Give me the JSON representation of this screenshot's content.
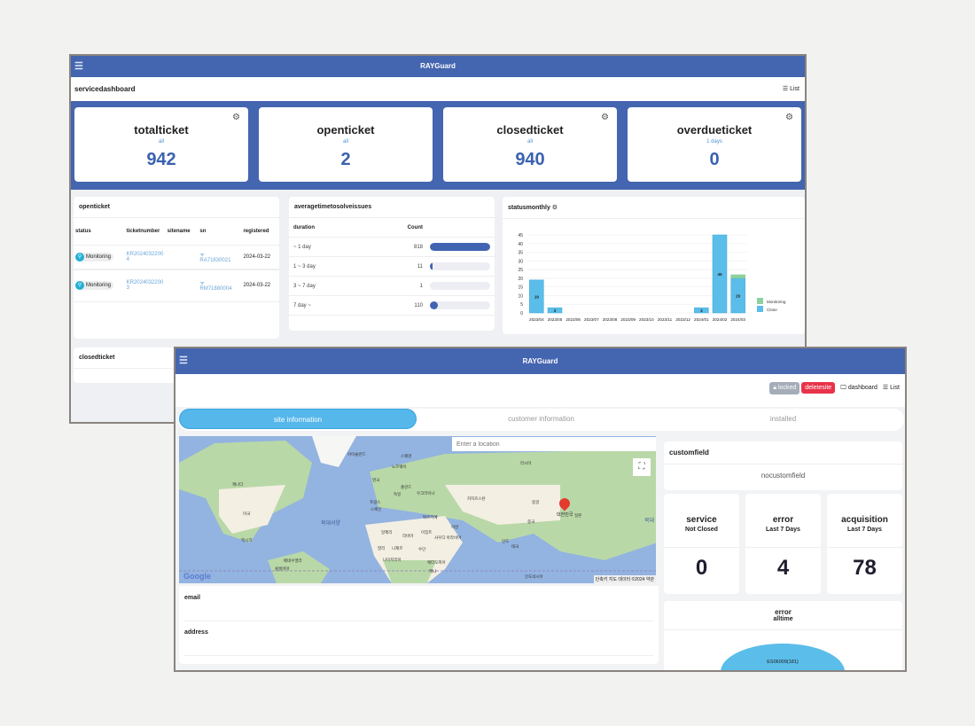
{
  "win1": {
    "title": "RAYGuard",
    "page": "servicedashboard",
    "list_label": "List",
    "kpis": [
      {
        "title": "totalticket",
        "sub": "all",
        "value": "942"
      },
      {
        "title": "openticket",
        "sub": "all",
        "value": "2"
      },
      {
        "title": "closedticket",
        "sub": "all",
        "value": "940"
      },
      {
        "title": "overdueticket",
        "sub": "1 days",
        "value": "0"
      }
    ],
    "openticket": {
      "title": "openticket",
      "headers": [
        "status",
        "ticketnumber",
        "sitename",
        "sn",
        "registered"
      ],
      "rows": [
        {
          "status": "Monitoring",
          "ticket": "KR20240322004",
          "site": "",
          "sn": "RA71830021",
          "registered": "2024-03-22"
        },
        {
          "status": "Monitoring",
          "ticket": "KR20240322003",
          "site": "",
          "sn": "RM71880004",
          "registered": "2024-03-22"
        }
      ]
    },
    "avg": {
      "title": "averagetimetosolveissues",
      "headers": [
        "duration",
        "Count"
      ],
      "rows": [
        {
          "label": "~ 1 day",
          "count": "818",
          "pct": 100
        },
        {
          "label": "1 ~ 3 day",
          "count": "11",
          "pct": 1.3
        },
        {
          "label": "3 ~ 7 day",
          "count": "1",
          "pct": 0.1
        },
        {
          "label": "7 day ~",
          "count": "110",
          "pct": 13.4
        }
      ]
    },
    "closedticket": {
      "title": "closedticket"
    }
  },
  "chart_data": {
    "type": "bar",
    "stacked": true,
    "title": "statusmonthly",
    "xlabel": "",
    "ylabel": "",
    "ylim": [
      0,
      45
    ],
    "yticks": [
      0,
      5,
      10,
      15,
      20,
      25,
      30,
      35,
      40,
      45
    ],
    "grid": true,
    "legend": "right",
    "categories": [
      "2023/04",
      "2023/05",
      "2023/06",
      "2023/07",
      "2023/08",
      "2023/09",
      "2023/10",
      "2023/11",
      "2023/12",
      "2024/01",
      "2024/02",
      "2024/03"
    ],
    "series": [
      {
        "name": "Close",
        "color": "#5bbde9",
        "values": [
          19,
          3,
          0,
          0,
          0,
          0,
          0,
          0,
          0,
          3,
          45,
          20
        ]
      },
      {
        "name": "Monitoring",
        "color": "#8fd19e",
        "values": [
          0,
          0,
          0,
          0,
          0,
          0,
          0,
          0,
          0,
          0,
          0,
          2
        ]
      }
    ]
  },
  "win2": {
    "title": "RAYGuard",
    "locked": "locked",
    "deletesite": "deletesite",
    "dashboard": "dashboard",
    "list": "List",
    "tabs": [
      "site information",
      "customer information",
      "installed"
    ],
    "map": {
      "placeholder": "Enter a location",
      "ocean": "북대서양",
      "ocean2": "북대",
      "marker": "대한민국",
      "google": "Google",
      "attribution": "단축키  지도 데이터 ©2024",
      "terms": "약관",
      "labels": [
        {
          "t": "캐나다"
        },
        {
          "t": "미국"
        },
        {
          "t": "멕시코"
        },
        {
          "t": "러시아"
        },
        {
          "t": "중국"
        },
        {
          "t": "몽골"
        },
        {
          "t": "카자흐스탄"
        },
        {
          "t": "인도"
        },
        {
          "t": "일본"
        },
        {
          "t": "알제리"
        },
        {
          "t": "리비아"
        },
        {
          "t": "이집트"
        },
        {
          "t": "말리"
        },
        {
          "t": "니제르"
        },
        {
          "t": "나이지리아"
        },
        {
          "t": "에티오피아"
        },
        {
          "t": "사우디 아라비아"
        },
        {
          "t": "이란"
        },
        {
          "t": "튀르키예"
        },
        {
          "t": "프랑스"
        },
        {
          "t": "독일"
        },
        {
          "t": "영국"
        },
        {
          "t": "스페인"
        },
        {
          "t": "폴란드"
        },
        {
          "t": "우크라이나"
        },
        {
          "t": "아이슬란드"
        },
        {
          "t": "스웨덴"
        },
        {
          "t": "노르웨이"
        },
        {
          "t": "베네수엘라"
        },
        {
          "t": "콜롬비아"
        },
        {
          "t": "태국"
        },
        {
          "t": "인도네시아"
        },
        {
          "t": "케냐"
        },
        {
          "t": "수단"
        }
      ]
    },
    "email_label": "email",
    "address_label": "address",
    "customfield": {
      "title": "customfield",
      "empty": "nocustomfield"
    },
    "stats": [
      {
        "title": "service",
        "sub": "Not Closed",
        "value": "0"
      },
      {
        "title": "error",
        "sub": "Last 7 Days",
        "value": "4"
      },
      {
        "title": "acquisition",
        "sub": "Last 7 Days",
        "value": "78"
      }
    ],
    "errorpie": {
      "title": "error",
      "sub": "alltime",
      "slice": "ES06009(181)",
      "color": "#5bbde9"
    }
  }
}
